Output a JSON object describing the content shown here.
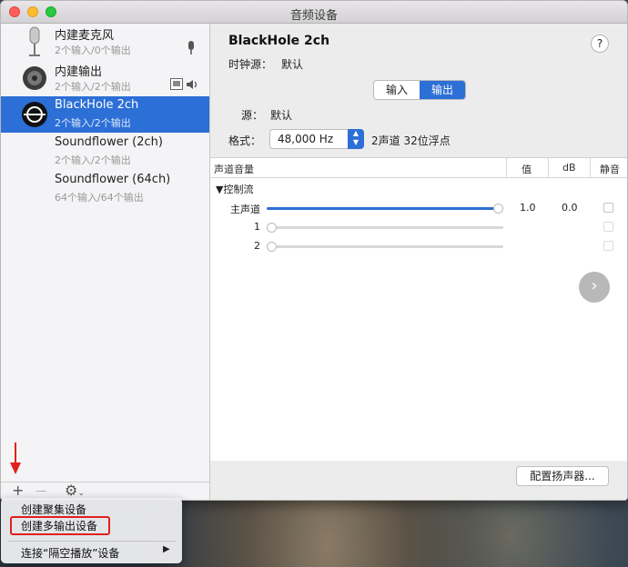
{
  "window": {
    "title": "音频设备"
  },
  "devices": [
    {
      "name": "内建麦克风",
      "sub": "2个输入/0个输出",
      "icon": "microphone-icon",
      "selected": false
    },
    {
      "name": "内建输出",
      "sub": "2个输入/2个输出",
      "icon": "speaker-icon",
      "selected": false
    },
    {
      "name": "BlackHole 2ch",
      "sub": "2个输入/2个输出",
      "icon": "blackhole-icon",
      "selected": true
    },
    {
      "name": "Soundflower (2ch)",
      "sub": "2个输入/2个输出",
      "icon": "",
      "selected": false
    },
    {
      "name": "Soundflower (64ch)",
      "sub": "64个输入/64个输出",
      "icon": "",
      "selected": false
    }
  ],
  "sidebar_bottom": {
    "add": "+",
    "remove": "—",
    "gear": "⚙"
  },
  "detail": {
    "title": "BlackHole 2ch",
    "clock_label": "时钟源：",
    "clock_value": "默认",
    "help": "?",
    "tabs": [
      {
        "label": "输入",
        "active": false
      },
      {
        "label": "输出",
        "active": true
      }
    ],
    "source_label": "源：",
    "source_value": "默认",
    "format_label": "格式：",
    "format_value": "48,000 Hz",
    "format_desc": "2声道 32位浮点"
  },
  "table": {
    "headers": {
      "volume": "声道音量",
      "value": "值",
      "db": "dB",
      "mute": "静音"
    },
    "group": "控制流",
    "rows": [
      {
        "label": "主声道",
        "level": 1.0,
        "value": "1.0",
        "db": "0.0"
      },
      {
        "label": "1",
        "level": 0.0,
        "value": "",
        "db": ""
      },
      {
        "label": "2",
        "level": 0.0,
        "value": "",
        "db": ""
      }
    ]
  },
  "config_button": "配置扬声器...",
  "menu": {
    "items": [
      "创建聚集设备",
      "创建多输出设备",
      "连接“隔空播放”设备"
    ],
    "submenu_arrow": "▶"
  },
  "colors": {
    "accent": "#2c6fd6",
    "highlight": "#e0201c"
  }
}
